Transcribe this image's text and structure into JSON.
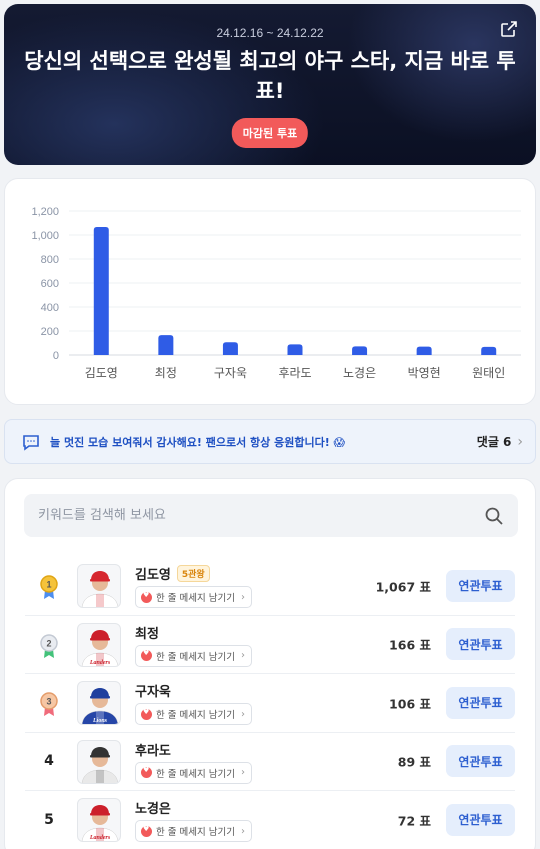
{
  "banner": {
    "dates": "24.12.16 ~ 24.12.22",
    "title": "당신의 선택으로 완성될 최고의 야구 스타, 지금 바로 투표!",
    "badge": "마감된 투표"
  },
  "chart_data": {
    "type": "bar",
    "categories": [
      "김도영",
      "최정",
      "구자욱",
      "후라도",
      "노경은",
      "박영현",
      "원태인"
    ],
    "values": [
      1067,
      166,
      106,
      89,
      72,
      70,
      68
    ],
    "yticks": [
      "0",
      "200",
      "400",
      "600",
      "800",
      "1,000",
      "1,200"
    ],
    "ylim": [
      0,
      1200
    ],
    "bar_color": "#2f5ce6",
    "grid": true
  },
  "comment": {
    "message": "늘 멋진 모습 보여줘서 감사해요! 팬으로서 항상 응원합니다! 😱",
    "count": "댓글 6"
  },
  "search": {
    "placeholder": "키워드를 검색해 보세요"
  },
  "players": [
    {
      "rank": "1",
      "medal": "gold",
      "name": "김도영",
      "tag": "5관왕",
      "message_label": "한 줄 메세지 남기기",
      "votes": "1,067 표",
      "vote_label": "연관투표",
      "uniform": "red"
    },
    {
      "rank": "2",
      "medal": "silver",
      "name": "최정",
      "tag": "",
      "message_label": "한 줄 메세지 남기기",
      "votes": "166 표",
      "vote_label": "연관투표",
      "uniform": "landers"
    },
    {
      "rank": "3",
      "medal": "bronze",
      "name": "구자욱",
      "tag": "",
      "message_label": "한 줄 메세지 남기기",
      "votes": "106 표",
      "vote_label": "연관투표",
      "uniform": "blue"
    },
    {
      "rank": "4",
      "medal": "",
      "name": "후라도",
      "tag": "",
      "message_label": "한 줄 메세지 남기기",
      "votes": "89 표",
      "vote_label": "연관투표",
      "uniform": "gray"
    },
    {
      "rank": "5",
      "medal": "",
      "name": "노경은",
      "tag": "",
      "message_label": "한 줄 메세지 남기기",
      "votes": "72 표",
      "vote_label": "연관투표",
      "uniform": "landers"
    }
  ]
}
